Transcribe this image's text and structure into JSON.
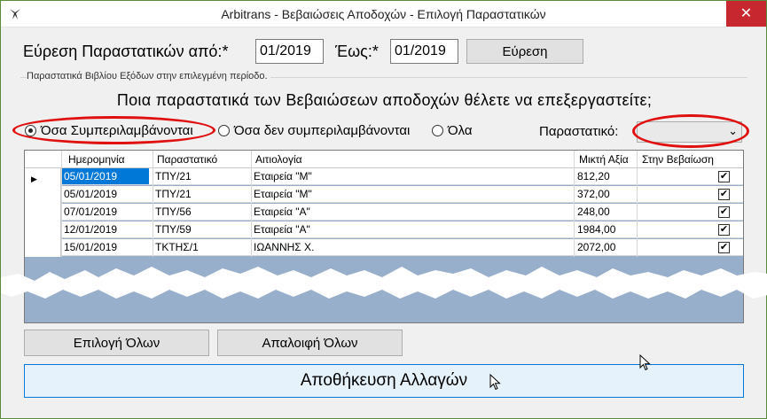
{
  "window": {
    "title": "Arbitrans - Βεβαιώσεις Αποδοχών - Επιλογή Παραστατικών",
    "close_label": "✕"
  },
  "search": {
    "from_label": "Εύρεση Παραστατικών από:*",
    "from_value": "01/2019",
    "to_label": "Έως:*",
    "to_value": "01/2019",
    "button_label": "Εύρεση"
  },
  "group": {
    "label": "Παραστατικά Βιβλίου Εξόδων στην επιλεγμένη περίοδο."
  },
  "question": "Ποια παραστατικά των Βεβαιώσεων αποδοχών θέλετε να επεξεργαστείτε;",
  "filters": {
    "included_label": "Όσα Συμπεριλαμβάνονται",
    "excluded_label": "Όσα δεν συμπεριλαμβάνονται",
    "all_label": "Όλα",
    "selected": "included",
    "document_label": "Παραστατικό:",
    "document_value": ""
  },
  "table": {
    "columns": [
      "Ημερομηνία",
      "Παραστατικό",
      "Αιτιολογία",
      "Μικτή Αξία",
      "Στην Βεβαίωση"
    ],
    "rows": [
      {
        "date": "05/01/2019",
        "doc": "ΤΠΥ/21",
        "reason": "Εταιρεία \"Μ\"",
        "amount": "812,20",
        "checked": "✔"
      },
      {
        "date": "05/01/2019",
        "doc": "ΤΠΥ/21",
        "reason": "Εταιρεία \"Μ\"",
        "amount": "372,00",
        "checked": "✔"
      },
      {
        "date": "07/01/2019",
        "doc": "ΤΠΥ/56",
        "reason": "Εταιρεία \"Α\"",
        "amount": "248,00",
        "checked": "✔"
      },
      {
        "date": "12/01/2019",
        "doc": "ΤΠΥ/59",
        "reason": "Εταιρεία \"Α\"",
        "amount": "1984,00",
        "checked": "✔"
      },
      {
        "date": "15/01/2019",
        "doc": "ΤΚΤΗΣ/1",
        "reason": "ΙΩΑΝΝΗΣ Χ.",
        "amount": "2072,00",
        "checked": "✔"
      }
    ]
  },
  "actions": {
    "select_all_label": "Επιλογή Όλων",
    "clear_all_label": "Απαλοιφή Όλων",
    "save_label": "Αποθήκευση Αλλαγών"
  },
  "colors": {
    "selection": "#0078d7",
    "grid_background": "#98afcb",
    "highlight_ellipse": "#e01010",
    "close_button": "#c7282f"
  }
}
